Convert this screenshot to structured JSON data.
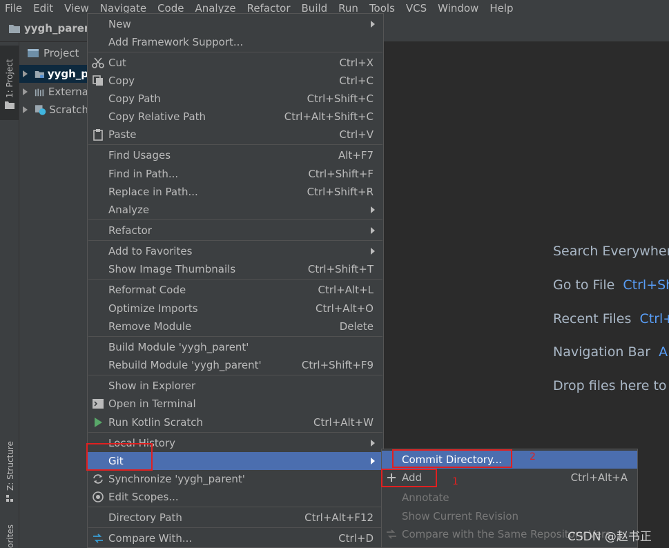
{
  "menubar": [
    "File",
    "Edit",
    "View",
    "Navigate",
    "Code",
    "Analyze",
    "Refactor",
    "Build",
    "Run",
    "Tools",
    "VCS",
    "Window",
    "Help"
  ],
  "breadcrumb": {
    "project": "yygh_parent"
  },
  "stripe": {
    "project_tab": "1: Project",
    "structure_tab": "Z: Structure",
    "favorites_tab": "orites"
  },
  "project_panel": {
    "title": "Project",
    "tree": [
      "yygh_p",
      "Externa",
      "Scratch"
    ]
  },
  "editor_hints": [
    {
      "label": "Search Everywhere",
      "key": ""
    },
    {
      "label": "Go to File",
      "key": "Ctrl+Sh"
    },
    {
      "label": "Recent Files",
      "key": "Ctrl+"
    },
    {
      "label": "Navigation Bar",
      "key": "A"
    },
    {
      "label": "Drop files here to",
      "key": ""
    }
  ],
  "context_menu": {
    "items": [
      {
        "label": "New",
        "shortcut": "",
        "submenu": true
      },
      {
        "label": "Add Framework Support...",
        "shortcut": ""
      },
      {
        "label": "Cut",
        "shortcut": "Ctrl+X",
        "icon": "scissors-icon"
      },
      {
        "label": "Copy",
        "shortcut": "Ctrl+C",
        "icon": "copy-icon"
      },
      {
        "label": "Copy Path",
        "shortcut": "Ctrl+Shift+C"
      },
      {
        "label": "Copy Relative Path",
        "shortcut": "Ctrl+Alt+Shift+C"
      },
      {
        "label": "Paste",
        "shortcut": "Ctrl+V",
        "icon": "clipboard-icon"
      },
      {
        "label": "Find Usages",
        "shortcut": "Alt+F7"
      },
      {
        "label": "Find in Path...",
        "shortcut": "Ctrl+Shift+F"
      },
      {
        "label": "Replace in Path...",
        "shortcut": "Ctrl+Shift+R"
      },
      {
        "label": "Analyze",
        "shortcut": "",
        "submenu": true
      },
      {
        "label": "Refactor",
        "shortcut": "",
        "submenu": true
      },
      {
        "label": "Add to Favorites",
        "shortcut": "",
        "submenu": true
      },
      {
        "label": "Show Image Thumbnails",
        "shortcut": "Ctrl+Shift+T"
      },
      {
        "label": "Reformat Code",
        "shortcut": "Ctrl+Alt+L"
      },
      {
        "label": "Optimize Imports",
        "shortcut": "Ctrl+Alt+O"
      },
      {
        "label": "Remove Module",
        "shortcut": "Delete"
      },
      {
        "label": "Build Module 'yygh_parent'",
        "shortcut": ""
      },
      {
        "label": "Rebuild Module 'yygh_parent'",
        "shortcut": "Ctrl+Shift+F9"
      },
      {
        "label": "Show in Explorer",
        "shortcut": ""
      },
      {
        "label": "Open in Terminal",
        "shortcut": "",
        "icon": "terminal-icon"
      },
      {
        "label": "Run Kotlin Scratch",
        "shortcut": "Ctrl+Alt+W",
        "icon": "run-icon"
      },
      {
        "label": "Local History",
        "shortcut": "",
        "submenu": true
      },
      {
        "label": "Git",
        "shortcut": "",
        "submenu": true
      },
      {
        "label": "Synchronize 'yygh_parent'",
        "shortcut": "",
        "icon": "sync-icon"
      },
      {
        "label": "Edit Scopes...",
        "shortcut": "",
        "icon": "scope-icon"
      },
      {
        "label": "Directory Path",
        "shortcut": "Ctrl+Alt+F12"
      },
      {
        "label": "Compare With...",
        "shortcut": "Ctrl+D",
        "icon": "compare-icon"
      }
    ]
  },
  "git_submenu": {
    "items": [
      {
        "label": "Commit Directory...",
        "shortcut": ""
      },
      {
        "label": "Add",
        "shortcut": "Ctrl+Alt+A"
      },
      {
        "label": "Annotate",
        "shortcut": ""
      },
      {
        "label": "Show Current Revision",
        "shortcut": ""
      },
      {
        "label": "Compare with the Same Repository Vers",
        "shortcut": ""
      }
    ]
  },
  "annotations": {
    "one": "1",
    "two": "2"
  },
  "watermark": "CSDN @赵书正",
  "colors": {
    "highlight": "#4b6eaf",
    "annotation": "#e02020",
    "hint_key": "#589df6"
  }
}
